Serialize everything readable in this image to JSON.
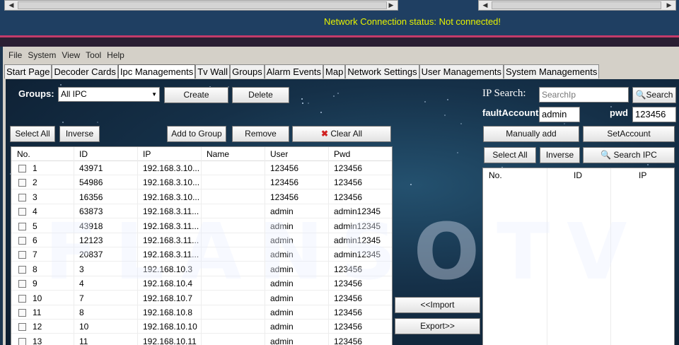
{
  "network_status": "Network Connection status: Not connected!",
  "menu": [
    "File",
    "System",
    "View",
    "Tool",
    "Help"
  ],
  "tabs": [
    "Start Page",
    "Decoder Cards",
    "Ipc Managements",
    "Tv Wall",
    "Groups",
    "Alarm Events",
    "Map",
    "Network Settings",
    "User Managements",
    "System Managements"
  ],
  "active_tab": "Ipc Managements",
  "groups_label": "Groups:",
  "groups_value": "All IPC",
  "buttons": {
    "create": "Create",
    "delete": "Delete",
    "select_all": "Select All",
    "inverse": "Inverse",
    "add_to_group": "Add to Group",
    "remove": "Remove",
    "clear_all": "Clear All",
    "import": "<<Import",
    "export": "Export>>",
    "search": "Search",
    "manually_add": "Manually add",
    "set_account": "SetAccount",
    "right_select_all": "Select All",
    "right_inverse": "Inverse",
    "search_ipc": "Search IPC"
  },
  "ip_search_label": "IP Search:",
  "search_placeholder": "SearchIp",
  "default_account_label": "faultAccount",
  "default_account_value": "admin",
  "pwd_label": "pwd",
  "pwd_value": "123456",
  "table_headers": [
    "No.",
    "ID",
    "IP",
    "Name",
    "User",
    "Pwd"
  ],
  "table_rows": [
    [
      "1",
      "43971",
      "192.168.3.10...",
      "",
      "123456",
      "123456"
    ],
    [
      "2",
      "54986",
      "192.168.3.10...",
      "",
      "123456",
      "123456"
    ],
    [
      "3",
      "16356",
      "192.168.3.10...",
      "",
      "123456",
      "123456"
    ],
    [
      "4",
      "63873",
      "192.168.3.11...",
      "",
      "admin",
      "admin12345"
    ],
    [
      "5",
      "43918",
      "192.168.3.11...",
      "",
      "admin",
      "admin12345"
    ],
    [
      "6",
      "12123",
      "192.168.3.11...",
      "",
      "admin",
      "admin12345"
    ],
    [
      "7",
      "20837",
      "192.168.3.11...",
      "",
      "admin",
      "admin12345"
    ],
    [
      "8",
      "3",
      "192.168.10.3",
      "",
      "admin",
      "123456"
    ],
    [
      "9",
      "4",
      "192.168.10.4",
      "",
      "admin",
      "123456"
    ],
    [
      "10",
      "7",
      "192.168.10.7",
      "",
      "admin",
      "123456"
    ],
    [
      "11",
      "8",
      "192.168.10.8",
      "",
      "admin",
      "123456"
    ],
    [
      "12",
      "10",
      "192.168.10.10",
      "",
      "admin",
      "123456"
    ],
    [
      "13",
      "11",
      "192.168.10.11",
      "",
      "admin",
      "123456"
    ]
  ],
  "right_table_headers": [
    "No.",
    "ID",
    "IP"
  ],
  "watermark": "FLANSOTV",
  "colors": {
    "status_text": "#e6f200",
    "accent_bar": "#c33b6a",
    "panel_bg": "#153048"
  }
}
